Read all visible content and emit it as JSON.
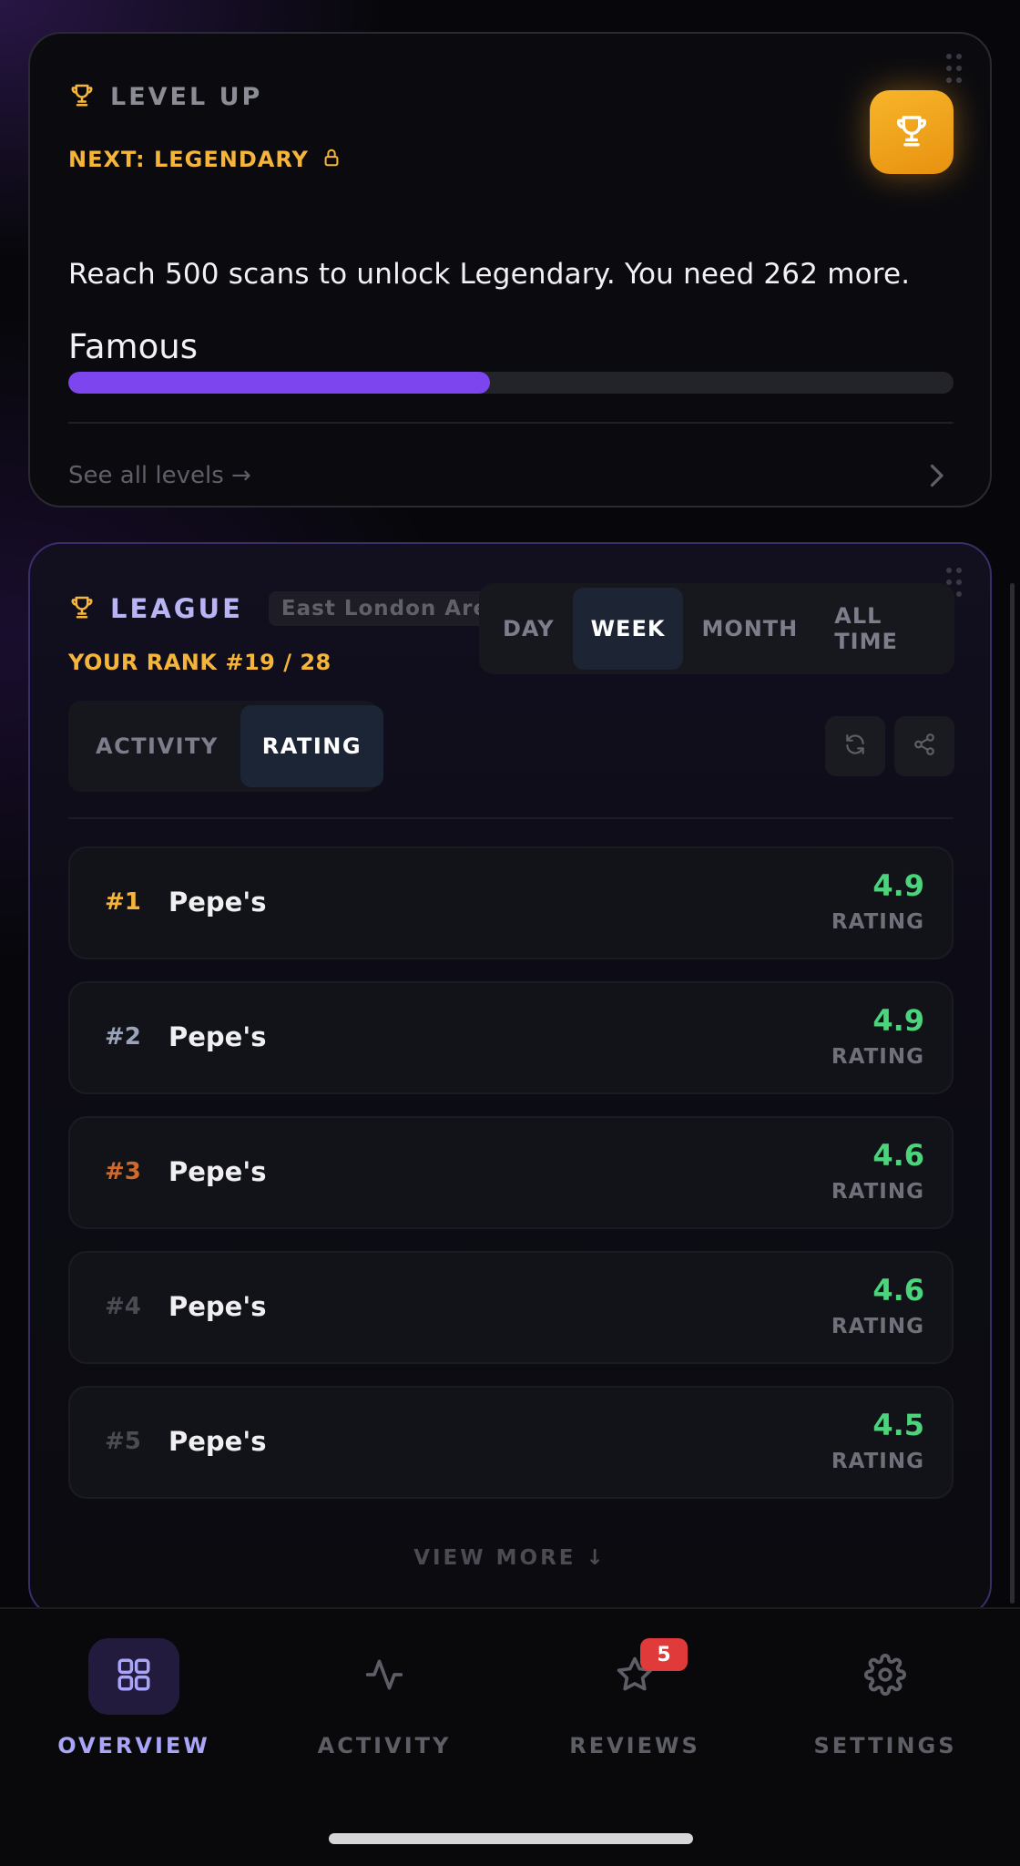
{
  "level_card": {
    "title": "LEVEL UP",
    "next_label": "NEXT: LEGENDARY",
    "description": "Reach 500 scans to unlock Legendary.  You need 262 more.",
    "current_level": "Famous",
    "progress_fraction": 0.476,
    "progress_color": "#7c45ee",
    "see_all": "See all levels →",
    "icons": [
      "trophy-icon",
      "lock-icon",
      "trophy-icon",
      "chevron-right-icon"
    ]
  },
  "league_card": {
    "title": "LEAGUE",
    "area": "East London Area",
    "rank": "YOUR RANK #19 / 28",
    "period_tabs": [
      {
        "label": "DAY",
        "active": false
      },
      {
        "label": "WEEK",
        "active": true
      },
      {
        "label": "MONTH",
        "active": false
      },
      {
        "label": "ALL TIME",
        "active": false
      }
    ],
    "mode_tabs": [
      {
        "label": "ACTIVITY",
        "active": false
      },
      {
        "label": "RATING",
        "active": true
      }
    ],
    "actions": [
      "refresh-icon",
      "share-icon"
    ],
    "rows": [
      {
        "rank": "#1",
        "name": "Pepe's",
        "value": "4.9",
        "unit": "RATING",
        "rank_color": "#f5b53a"
      },
      {
        "rank": "#2",
        "name": "Pepe's",
        "value": "4.9",
        "unit": "RATING",
        "rank_color": "#9aa3b8"
      },
      {
        "rank": "#3",
        "name": "Pepe's",
        "value": "4.6",
        "unit": "RATING",
        "rank_color": "#d06a2a"
      },
      {
        "rank": "#4",
        "name": "Pepe's",
        "value": "4.6",
        "unit": "RATING",
        "rank_color": "#4a4b53"
      },
      {
        "rank": "#5",
        "name": "Pepe's",
        "value": "4.5",
        "unit": "RATING",
        "rank_color": "#4a4b53"
      }
    ],
    "view_more": "VIEW MORE ↓"
  },
  "bottom_nav": [
    {
      "label": "OVERVIEW",
      "icon": "grid-icon",
      "active": true
    },
    {
      "label": "ACTIVITY",
      "icon": "activity-icon",
      "active": false
    },
    {
      "label": "REVIEWS",
      "icon": "star-icon",
      "active": false,
      "badge": "5"
    },
    {
      "label": "SETTINGS",
      "icon": "gear-icon",
      "active": false
    }
  ],
  "colors": {
    "accent_purple": "#7c45ee",
    "gold": "#f5b53a",
    "rating_green": "#4cd47c",
    "nav_active": "#a9a5f8"
  }
}
